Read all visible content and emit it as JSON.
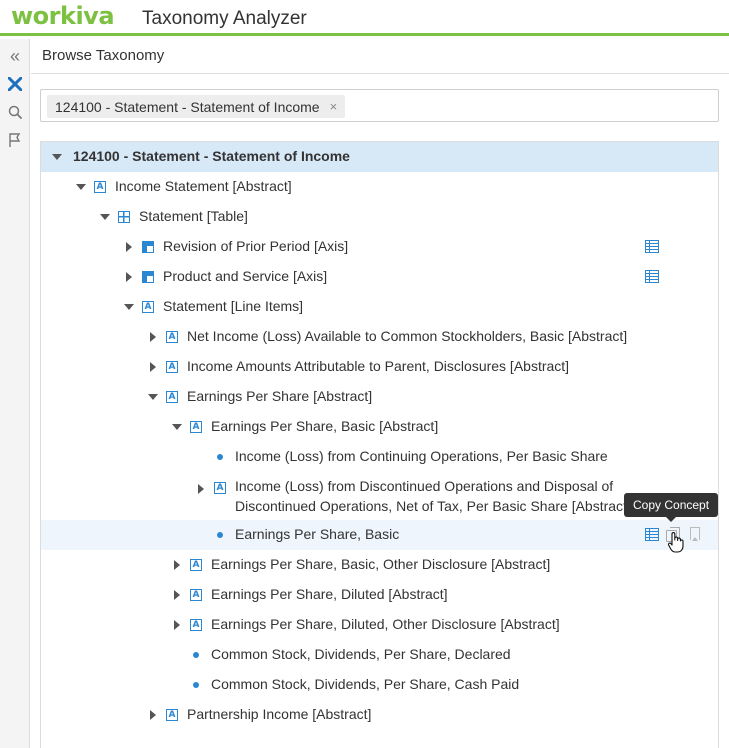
{
  "header": {
    "logo": "workiva",
    "title": "Taxonomy Analyzer",
    "accent_color": "#7dc142"
  },
  "rail": {
    "items": [
      {
        "icon": "collapse-icon",
        "glyph": "«"
      },
      {
        "icon": "x-brand-icon",
        "glyph": "✕"
      },
      {
        "icon": "search-icon",
        "glyph": "⌕"
      },
      {
        "icon": "bookmark-icon",
        "glyph": "⚑"
      }
    ]
  },
  "panel": {
    "title": "Browse Taxonomy"
  },
  "filter": {
    "chip_label": "124100 - Statement - Statement of Income",
    "chip_close": "×"
  },
  "tree": {
    "rows": [
      {
        "label": "124100 - Statement - Statement of Income",
        "expanded": true
      },
      {
        "label": "Income Statement [Abstract]",
        "icon": "abstract",
        "expanded": true
      },
      {
        "label": "Statement [Table]",
        "icon": "table",
        "expanded": true
      },
      {
        "label": "Revision of Prior Period [Axis]",
        "icon": "axis",
        "expanded": false
      },
      {
        "label": "Product and Service [Axis]",
        "icon": "axis",
        "expanded": false
      },
      {
        "label": "Statement [Line Items]",
        "icon": "abstract",
        "expanded": true
      },
      {
        "label": "Net Income (Loss) Available to Common Stockholders, Basic [Abstract]",
        "icon": "abstract",
        "expanded": false
      },
      {
        "label": "Income Amounts Attributable to Parent, Disclosures [Abstract]",
        "icon": "abstract",
        "expanded": false
      },
      {
        "label": "Earnings Per Share [Abstract]",
        "icon": "abstract",
        "expanded": true
      },
      {
        "label": "Earnings Per Share, Basic [Abstract]",
        "icon": "abstract",
        "expanded": true
      },
      {
        "label": "Income (Loss) from Continuing Operations, Per Basic Share",
        "icon": "concept"
      },
      {
        "label": "Income (Loss) from Discontinued Operations and Disposal of Discontinued Operations, Net of Tax, Per Basic Share [Abstract]",
        "icon": "abstract",
        "expanded": false
      },
      {
        "label": "Earnings Per Share, Basic",
        "icon": "concept"
      },
      {
        "label": "Earnings Per Share, Basic, Other Disclosure [Abstract]",
        "icon": "abstract",
        "expanded": false
      },
      {
        "label": "Earnings Per Share, Diluted [Abstract]",
        "icon": "abstract",
        "expanded": false
      },
      {
        "label": "Earnings Per Share, Diluted, Other Disclosure [Abstract]",
        "icon": "abstract",
        "expanded": false
      },
      {
        "label": "Common Stock, Dividends, Per Share, Declared",
        "icon": "concept"
      },
      {
        "label": "Common Stock, Dividends, Per Share, Cash Paid",
        "icon": "concept"
      },
      {
        "label": "Partnership Income [Abstract]",
        "icon": "abstract",
        "expanded": false
      }
    ]
  },
  "tooltip": {
    "text": "Copy Concept"
  },
  "colors": {
    "selected_row": "#d7e8f7",
    "icon_blue": "#2b87d1"
  }
}
